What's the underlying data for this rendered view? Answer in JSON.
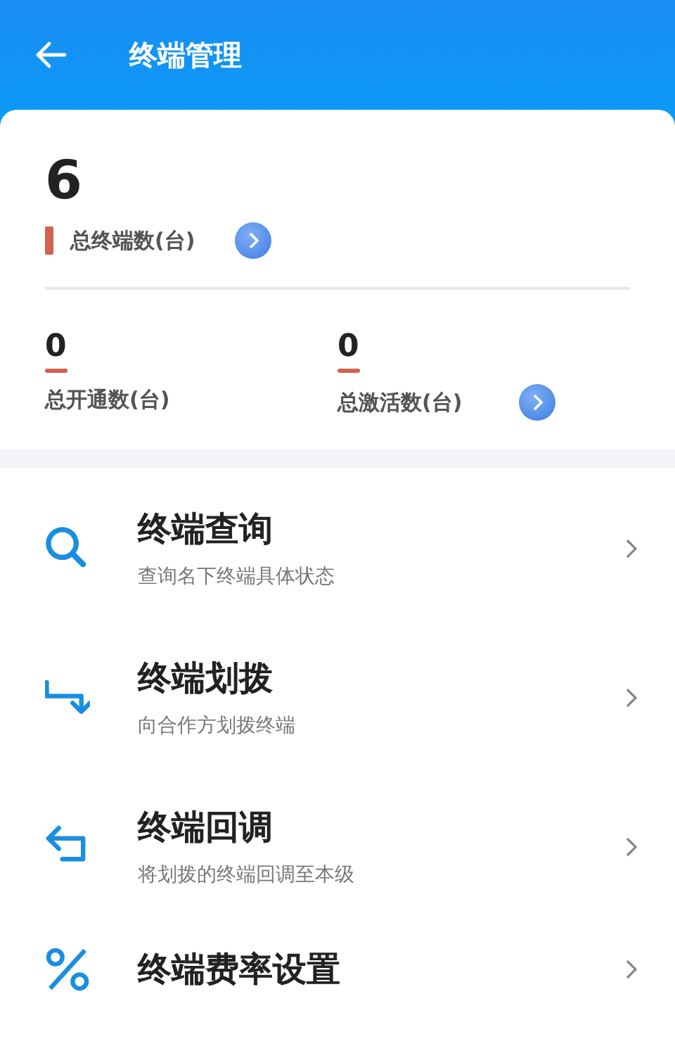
{
  "header": {
    "title": "终端管理"
  },
  "summary": {
    "total": {
      "value": "6",
      "label": "总终端数(台)"
    },
    "stats": [
      {
        "value": "0",
        "label": "总开通数(台)",
        "has_link": false
      },
      {
        "value": "0",
        "label": "总激活数(台)",
        "has_link": true
      }
    ]
  },
  "menu": [
    {
      "kind": "search",
      "title": "终端查询",
      "subtitle": "查询名下终端具体状态"
    },
    {
      "kind": "transfer",
      "title": "终端划拨",
      "subtitle": "向合作方划拨终端"
    },
    {
      "kind": "return",
      "title": "终端回调",
      "subtitle": "将划拨的终端回调至本级"
    },
    {
      "kind": "rate",
      "title": "终端费率设置"
    }
  ]
}
